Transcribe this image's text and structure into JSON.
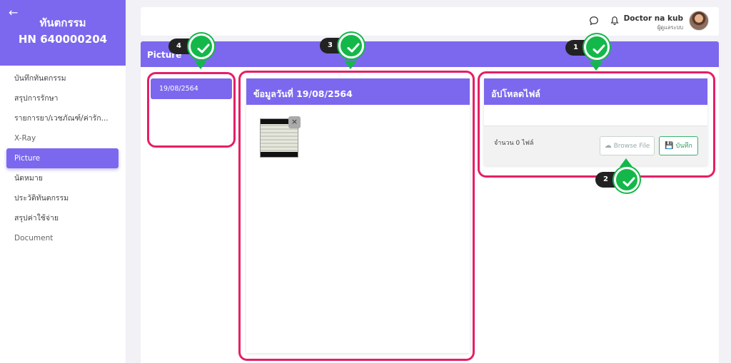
{
  "sidebar": {
    "title": "ทันตกรรม",
    "hn": "HN 640000204",
    "items": [
      {
        "label": "บันทึกทันตกรรม"
      },
      {
        "label": "สรุปการรักษา"
      },
      {
        "label": "รายการยา/เวชภัณฑ์/ค่ารัก..."
      },
      {
        "label": "X-Ray"
      },
      {
        "label": "Picture"
      },
      {
        "label": "นัดหมาย"
      },
      {
        "label": "ประวัติทันตกรรม"
      },
      {
        "label": "สรุปค่าใช้จ่าย"
      },
      {
        "label": "Document"
      }
    ]
  },
  "topbar": {
    "user_name": "Doctor na kub",
    "user_role": "ผู้ดูแลระบบ"
  },
  "main": {
    "title": "Picture",
    "dates": [
      "19/08/2564"
    ],
    "data_panel_title": "ข้อมูลวันที่ 19/08/2564",
    "upload_title": "อัปโหลดไฟล์",
    "file_count": "จำนวน 0 ไฟล์",
    "browse_label": "Browse File",
    "save_label": "บันทึก"
  },
  "markers": {
    "m1": "1",
    "m2": "2",
    "m3": "3",
    "m4": "4"
  },
  "colors": {
    "accent": "#7b68ee",
    "highlight": "#e61e64",
    "check": "#14b84a"
  }
}
